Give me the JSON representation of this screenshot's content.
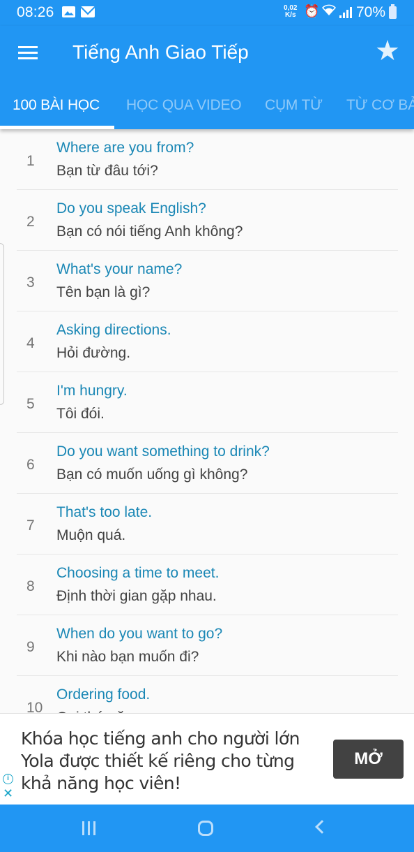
{
  "status_bar": {
    "time": "08:26",
    "notification_icons": [
      "gallery-icon",
      "mail-icon"
    ],
    "net_speed_value": "0,02",
    "net_speed_unit": "K/s",
    "alarm_icon": "⏰",
    "wifi_icon": "wifi-icon",
    "battery_percent": "70%"
  },
  "app_bar": {
    "title": "Tiếng Anh Giao Tiếp",
    "menu_icon": "hamburger-menu-icon",
    "favorite_icon": "★"
  },
  "tabs": [
    {
      "label": "100 BÀI HỌC",
      "active": true
    },
    {
      "label": "HỌC QUA VIDEO",
      "active": false
    },
    {
      "label": "CỤM TỪ",
      "active": false
    },
    {
      "label": "TỪ CƠ BẢN",
      "active": false
    }
  ],
  "lessons": [
    {
      "number": "1",
      "english": "Where are you from?",
      "vietnamese": "Bạn từ đâu tới?"
    },
    {
      "number": "2",
      "english": "Do you speak English?",
      "vietnamese": "Bạn có nói tiếng Anh không?"
    },
    {
      "number": "3",
      "english": "What's your name?",
      "vietnamese": "Tên bạn là gì?"
    },
    {
      "number": "4",
      "english": "Asking directions.",
      "vietnamese": "Hỏi đường."
    },
    {
      "number": "5",
      "english": "I'm hungry.",
      "vietnamese": "Tôi đói."
    },
    {
      "number": "6",
      "english": "Do you want something to drink?",
      "vietnamese": "Bạn có muốn uống gì không?"
    },
    {
      "number": "7",
      "english": "That's too late.",
      "vietnamese": "Muộn quá."
    },
    {
      "number": "8",
      "english": "Choosing a time to meet.",
      "vietnamese": "Định thời gian gặp nhau."
    },
    {
      "number": "9",
      "english": "When do you want to go?",
      "vietnamese": "Khi nào bạn muốn đi?"
    },
    {
      "number": "10",
      "english": "Ordering food.",
      "vietnamese": "Gọi thức ăn."
    }
  ],
  "ad": {
    "text": "Khóa học tiếng anh cho người lớn Yola được thiết kế riêng cho từng khả năng học viên!",
    "button_label": "MỞ",
    "info_icon": "i",
    "close_icon": "✕"
  },
  "colors": {
    "primary": "#2196f3",
    "english_text": "#1a87b5",
    "vietnamese_text": "#424242",
    "ad_button": "#424242"
  }
}
